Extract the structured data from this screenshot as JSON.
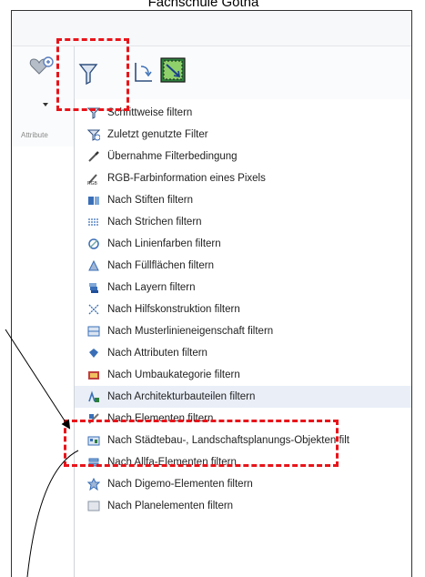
{
  "header": {
    "title": "Fachschule Gotha"
  },
  "ribbon": {
    "group_label": "Attribute",
    "buttons": [
      {
        "icon": "attribute-heart-icon"
      },
      {
        "icon": "filter-funnel-icon"
      },
      {
        "icon": "reference-point-icon"
      },
      {
        "icon": "select-area-icon"
      }
    ]
  },
  "menu": {
    "items": [
      {
        "label": "Schrittweise filtern",
        "icon": "filter-step-icon"
      },
      {
        "label": "Zuletzt genutzte Filter",
        "icon": "filter-recent-icon"
      },
      {
        "label": "Übernahme Filterbedingung",
        "icon": "pipette-icon"
      },
      {
        "label": "RGB-Farbinformation eines Pixels",
        "icon": "rgb-pixel-icon"
      },
      {
        "label": "Nach Stiften filtern",
        "icon": "pen-filter-icon"
      },
      {
        "label": "Nach Strichen filtern",
        "icon": "stroke-filter-icon"
      },
      {
        "label": "Nach Linienfarben filtern",
        "icon": "line-color-icon"
      },
      {
        "label": "Nach Füllflächen filtern",
        "icon": "fill-area-icon"
      },
      {
        "label": "Nach Layern filtern",
        "icon": "layer-icon"
      },
      {
        "label": "Nach Hilfskonstruktion filtern",
        "icon": "construction-icon"
      },
      {
        "label": "Nach Musterlinieneigenschaft filtern",
        "icon": "pattern-line-icon"
      },
      {
        "label": "Nach Attributen filtern",
        "icon": "attribute-icon"
      },
      {
        "label": "Nach Umbaukategorie filtern",
        "icon": "renovation-icon"
      },
      {
        "label": "Nach Architekturbauteilen filtern",
        "icon": "architecture-icon"
      },
      {
        "label": "Nach Elementen filtern",
        "icon": "element-icon"
      },
      {
        "label": "Nach Städtebau-, Landschaftsplanungs-Objekten filt",
        "icon": "urban-planning-icon"
      },
      {
        "label": "Nach Allfa-Elementen filtern",
        "icon": "allfa-icon"
      },
      {
        "label": "Nach Digemo-Elementen filtern",
        "icon": "digemo-icon"
      },
      {
        "label": "Nach Planelementen filtern",
        "icon": "plan-element-icon"
      }
    ]
  },
  "colors": {
    "accent_red": "#e8141a",
    "icon_blue": "#3a6fb7"
  }
}
